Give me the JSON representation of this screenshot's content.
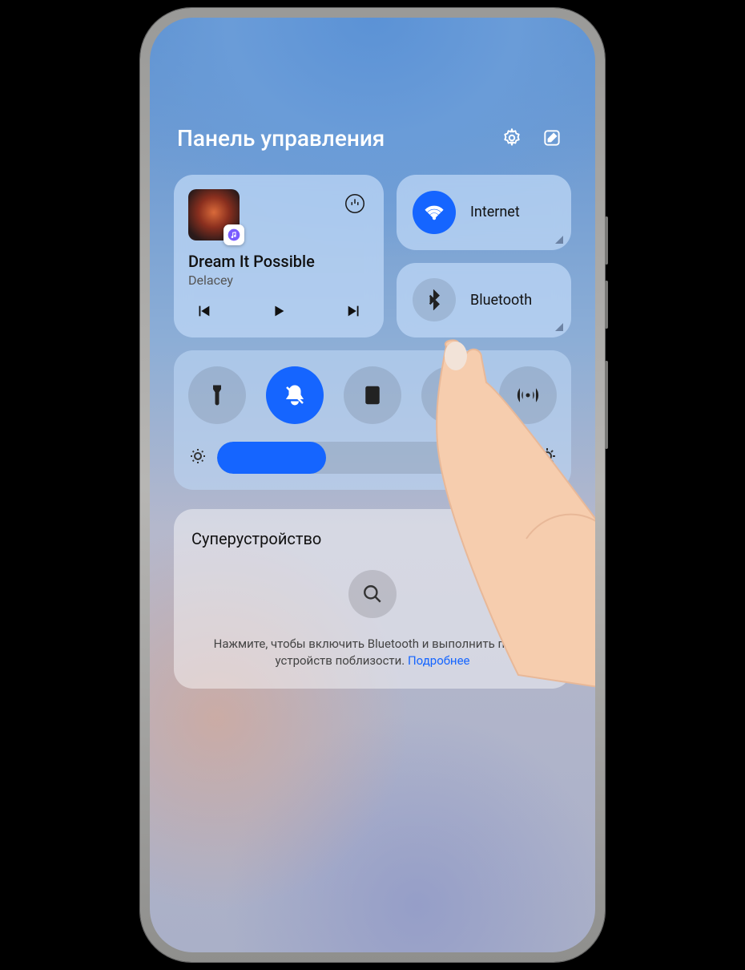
{
  "header": {
    "title": "Панель управления"
  },
  "media": {
    "track_title": "Dream It Possible",
    "artist": "Delacey"
  },
  "toggles": {
    "internet_label": "Internet",
    "bluetooth_label": "Bluetooth"
  },
  "super_device": {
    "title": "Суперустройство",
    "hint_text": "Нажмите, чтобы включить Bluetooth и выполнить поиск устройств поблизости. ",
    "hint_link": "Подробнее"
  },
  "brightness": {
    "value_percent": 35
  }
}
